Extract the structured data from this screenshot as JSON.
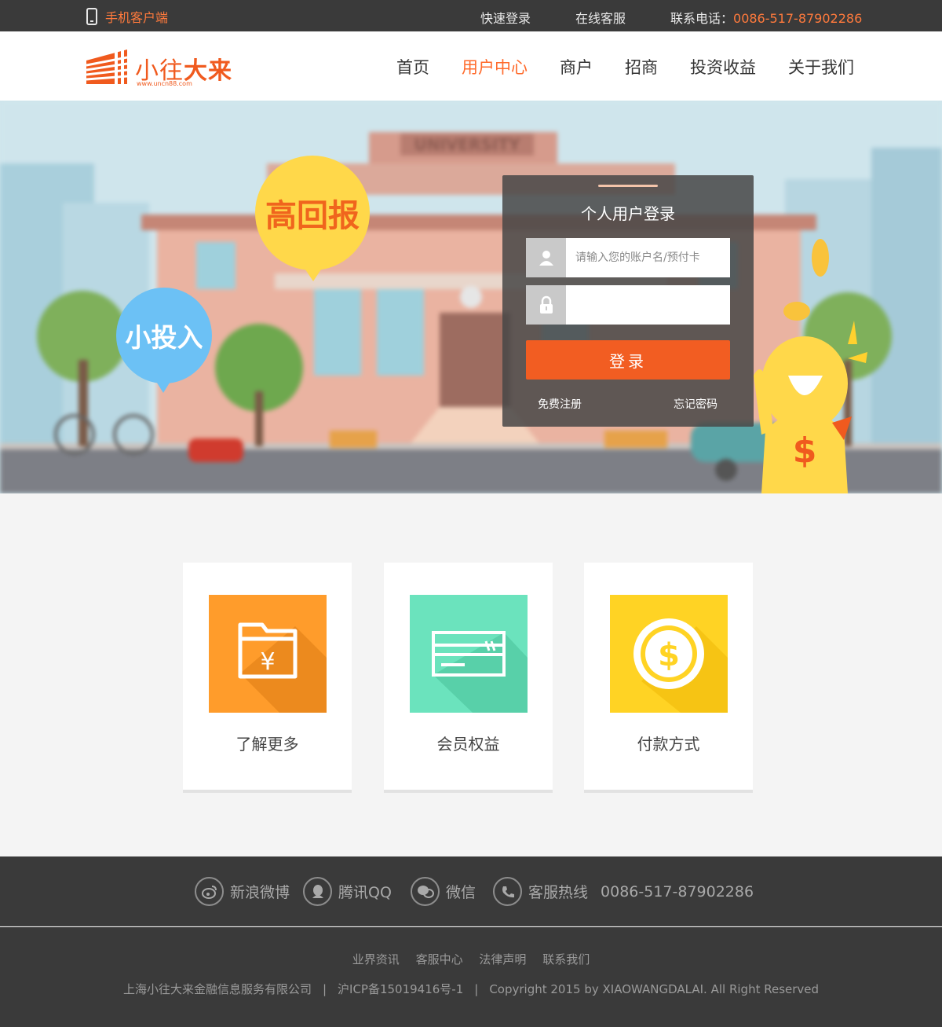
{
  "topbar": {
    "mobile_label": "手机客户端",
    "quick_login": "快速登录",
    "online_service": "在线客服",
    "phone_label": "联系电话：",
    "phone_number": "0086-517-87902286"
  },
  "header": {
    "logo_text_a": "小往",
    "logo_text_b": "大来",
    "logo_url": "www.uncn88.com",
    "nav": [
      "首页",
      "用户中心",
      "商户",
      "招商",
      "投资收益",
      "关于我们"
    ],
    "active_nav": "用户中心"
  },
  "hero": {
    "bubble_high": "高回报",
    "bubble_low": "小投入",
    "building_sign": "UNIVERSITY",
    "login": {
      "title": "个人用户登录",
      "username_placeholder": "请输入您的账户名/预付卡",
      "password_placeholder": "",
      "submit": "登录",
      "register": "免费注册",
      "forgot": "忘记密码"
    }
  },
  "features": [
    {
      "label": "了解更多",
      "color": "#ff9c2b",
      "icon": "folder-yen-icon"
    },
    {
      "label": "会员权益",
      "color": "#6be3bd",
      "icon": "card-icon"
    },
    {
      "label": "付款方式",
      "color": "#ffd324",
      "icon": "dollar-coin-icon"
    }
  ],
  "footer": {
    "weibo": "新浪微博",
    "qq": "腾讯QQ",
    "wechat": "微信",
    "hotline_label": "客服热线",
    "hotline_number": "0086-517-87902286",
    "links": [
      "业界资讯",
      "客服中心",
      "法律声明",
      "联系我们"
    ],
    "company": "上海小往大来金融信息服务有限公司",
    "icp": "沪ICP备15019416号-1",
    "copyright": "Copyright 2015 by XIAOWANGDALAI. All Right Reserved"
  },
  "colors": {
    "accent": "#ff6a2b",
    "login_button": "#f25d22",
    "dark_bar": "#3a3a3a"
  }
}
